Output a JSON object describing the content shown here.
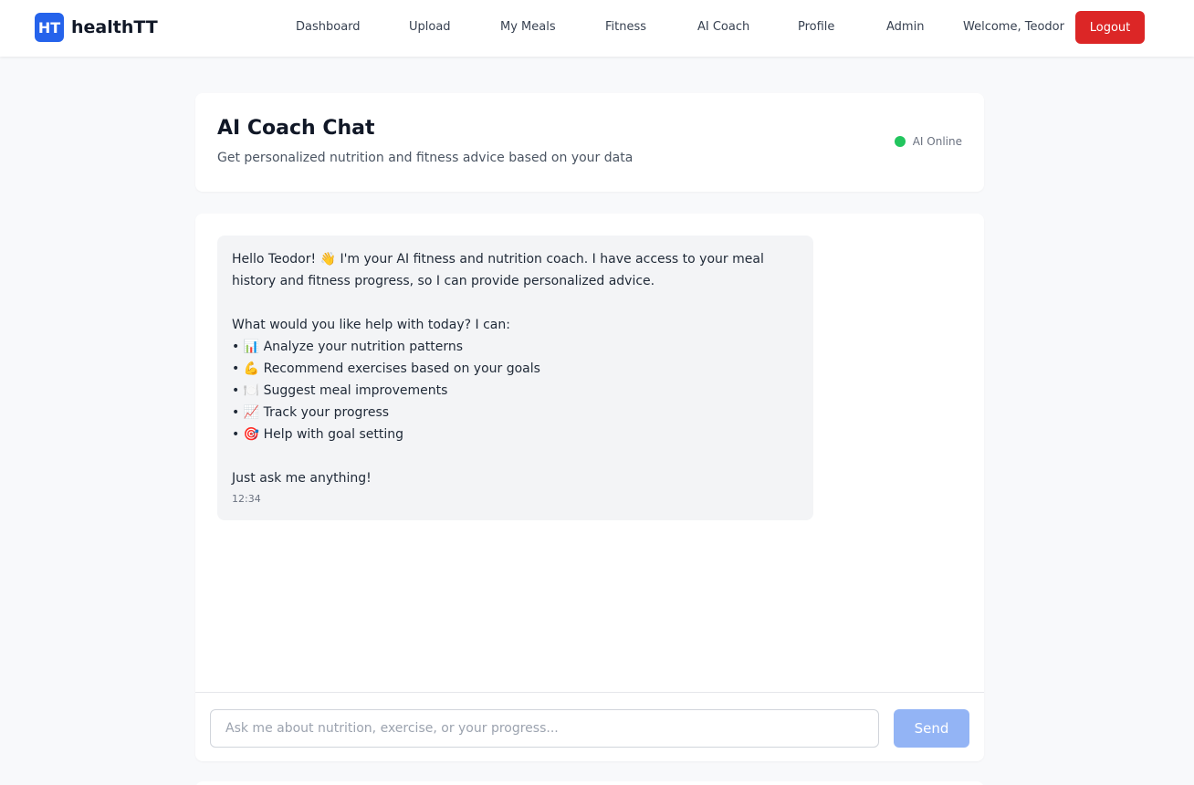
{
  "brand": {
    "logo_text": "HT",
    "name": "healthTT"
  },
  "nav": {
    "links": [
      {
        "label": "Dashboard"
      },
      {
        "label": "Upload"
      },
      {
        "label": "My Meals"
      },
      {
        "label": "Fitness"
      },
      {
        "label": "AI Coach"
      },
      {
        "label": "Profile"
      },
      {
        "label": "Admin"
      }
    ],
    "welcome": "Welcome, Teodor",
    "logout_label": "Logout"
  },
  "header": {
    "title": "AI Coach Chat",
    "subtitle": "Get personalized nutrition and fitness advice based on your data",
    "status": "AI Online"
  },
  "chat": {
    "message": {
      "lines": [
        "Hello Teodor! 👋 I'm your AI fitness and nutrition coach. I have access to your meal",
        "history and fitness progress, so I can provide personalized advice.",
        "What would you like help with today? I can:",
        "• 📊 Analyze your nutrition patterns",
        "• 💪 Recommend exercises based on your goals",
        "• 🍽️ Suggest meal improvements",
        "• 📈 Track your progress",
        "• 🎯 Help with goal setting",
        "Just ask me anything!"
      ],
      "time": "12:34"
    },
    "input_placeholder": "Ask me about nutrition, exercise, or your progress...",
    "send_label": "Send"
  },
  "colors": {
    "accent": "#2563eb",
    "logout": "#dc2626",
    "status_online": "#22c55e",
    "send_disabled": "#93b4f5"
  }
}
